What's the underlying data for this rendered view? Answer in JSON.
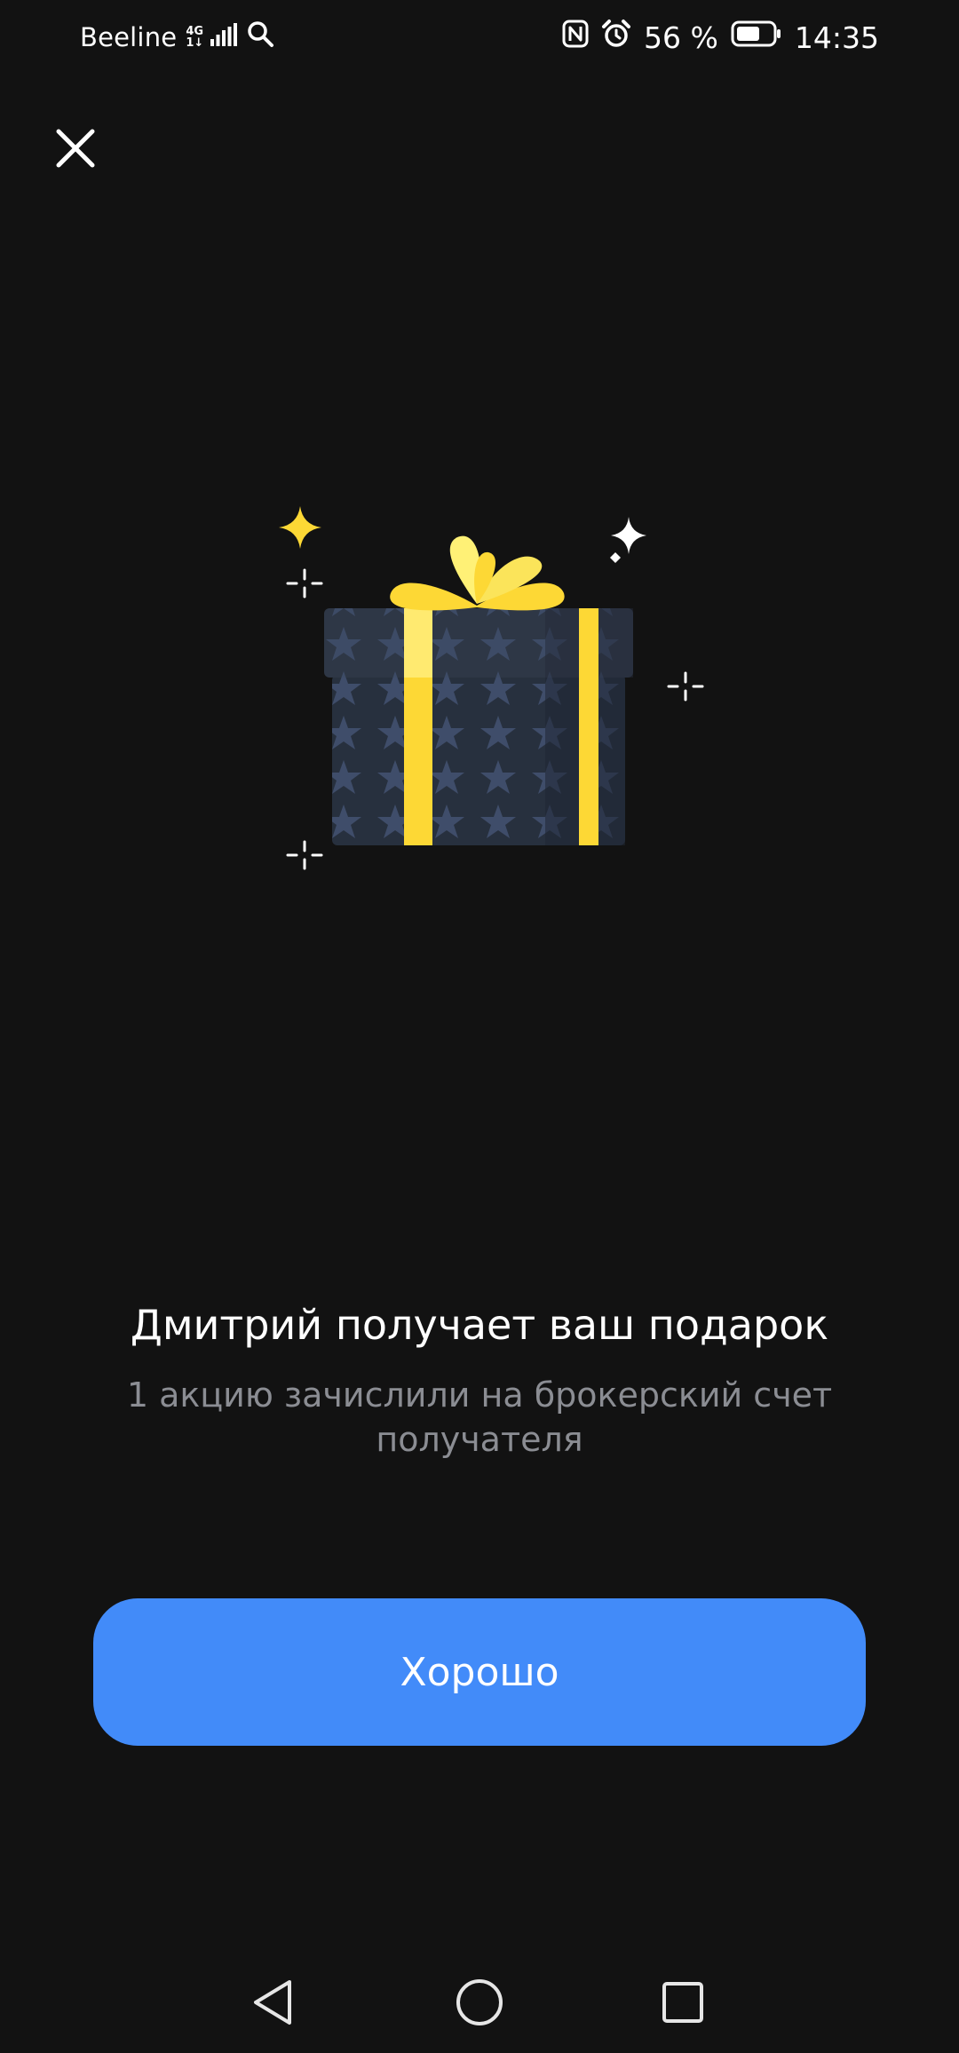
{
  "status_bar": {
    "carrier": "Beeline",
    "network_top": "4G",
    "network_bottom": "1↓",
    "battery_percent": "56 %",
    "time": "14:35",
    "icons": [
      "signal-icon",
      "search-icon",
      "nfc-icon",
      "alarm-icon",
      "battery-icon"
    ]
  },
  "header": {
    "close_icon": "close-icon"
  },
  "illustration": {
    "name": "gift-box-illustration",
    "colors": {
      "box": "#2b3341",
      "stars": "#3d4a66",
      "ribbon": "#fdd835",
      "bow_light": "#fff176"
    }
  },
  "content": {
    "title": "Дмитрий получает ваш подарок",
    "subtitle": "1 акцию зачислили на брокерский счет получателя"
  },
  "actions": {
    "ok_label": "Хорошо",
    "ok_color": "#428bf9"
  },
  "navigation": {
    "back_icon": "back-triangle-icon",
    "home_icon": "home-circle-icon",
    "recents_icon": "recents-square-icon"
  }
}
